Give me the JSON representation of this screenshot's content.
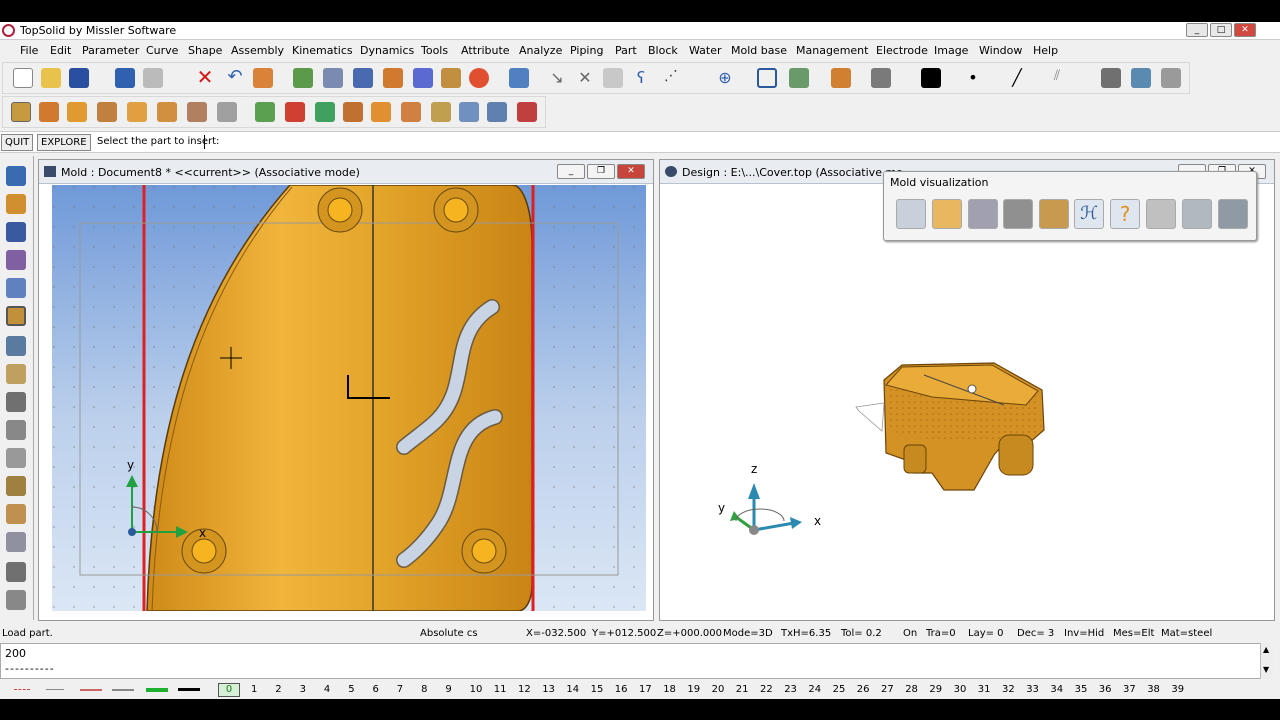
{
  "app": {
    "title": "TopSolid by Missler Software"
  },
  "menu": [
    "File",
    "Edit",
    "Parameter",
    "Curve",
    "Shape",
    "Assembly",
    "Kinematics",
    "Dynamics",
    "Tools",
    "Attribute",
    "Analyze",
    "Piping",
    "Part",
    "Block",
    "Water",
    "Mold base",
    "Management",
    "Electrode",
    "Image",
    "Window",
    "Help"
  ],
  "command": {
    "quit": "QUIT",
    "explore": "EXPLORE",
    "prompt": "Select the part to insert:"
  },
  "left_view": {
    "title": "Mold : Document8 *  <<current>> (Associative mode)",
    "axis_x": "x",
    "axis_y": "y"
  },
  "right_view": {
    "title": "Design : E:\\...\\Cover.top  (Associative mo",
    "axis_x": "x",
    "axis_y": "y",
    "axis_z": "z"
  },
  "mold_vis": {
    "title": "Mold visualization"
  },
  "status": {
    "msg": "Load part.",
    "cs": "Absolute cs",
    "x": "X=-032.500",
    "y": "Y=+012.500",
    "z": "Z=+000.000",
    "mode": "Mode=3D",
    "txh": "TxH=6.35",
    "tol": "Tol=  0.2",
    "on": "On",
    "tra": "Tra=0",
    "lay": "Lay=  0",
    "dec": "Dec= 3",
    "inv": "Inv=Hid",
    "mes": "Mes=Elt",
    "mat": "Mat=steel"
  },
  "cmdline": {
    "value": "200",
    "dashes": "----------"
  },
  "layers": {
    "current": "0",
    "numbers": [
      "1",
      "2",
      "3",
      "4",
      "5",
      "6",
      "7",
      "8",
      "9",
      "10",
      "11",
      "12",
      "13",
      "14",
      "15",
      "16",
      "17",
      "18",
      "19",
      "20",
      "21",
      "22",
      "23",
      "24",
      "25",
      "26",
      "27",
      "28",
      "29",
      "30",
      "31",
      "32",
      "33",
      "34",
      "35",
      "36",
      "37",
      "38",
      "39"
    ]
  },
  "colors": {
    "part": "#e3a52a",
    "part_dark": "#b57a10",
    "red_line": "#e02020",
    "bg_top": "#6f99d8"
  }
}
